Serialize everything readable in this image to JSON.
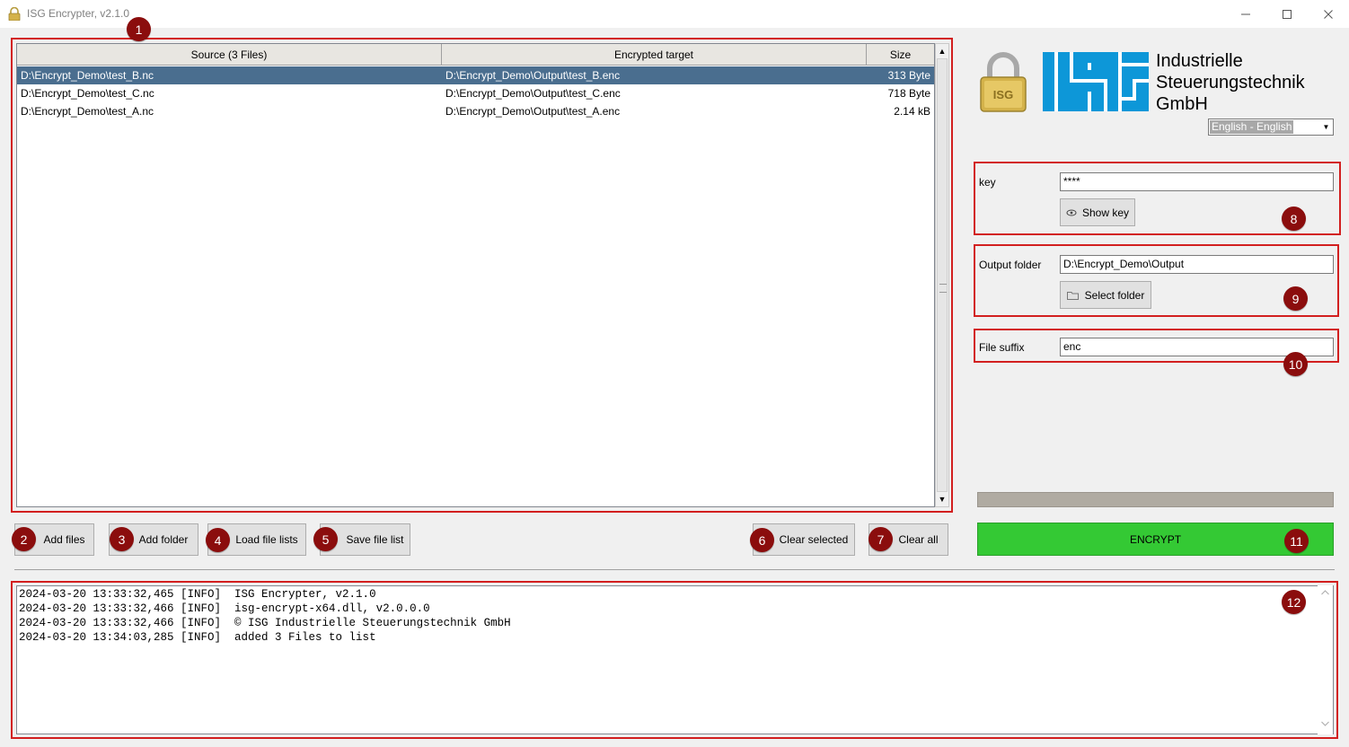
{
  "window": {
    "title": "ISG Encrypter, v2.1.0",
    "minimize_icon": "minimize-icon",
    "maximize_icon": "maximize-icon",
    "close_icon": "close-icon"
  },
  "file_table": {
    "columns": [
      "Source (3 Files)",
      "Encrypted target",
      "Size"
    ],
    "rows": [
      {
        "source": "D:\\Encrypt_Demo\\test_B.nc",
        "target": "D:\\Encrypt_Demo\\Output\\test_B.enc",
        "size": "313 Byte",
        "selected": true
      },
      {
        "source": "D:\\Encrypt_Demo\\test_C.nc",
        "target": "D:\\Encrypt_Demo\\Output\\test_C.enc",
        "size": "718 Byte",
        "selected": false
      },
      {
        "source": "D:\\Encrypt_Demo\\test_A.nc",
        "target": "D:\\Encrypt_Demo\\Output\\test_A.enc",
        "size": "2.14 kB",
        "selected": false
      }
    ]
  },
  "toolbar": {
    "add_files": "Add files",
    "add_folder": "Add folder",
    "load_file_lists": "Load file lists",
    "save_file_list": "Save file list",
    "clear_selected": "Clear selected",
    "clear_all": "Clear all"
  },
  "brand": {
    "logo_text": "ISG",
    "company_line1": "Industrielle",
    "company_line2": "Steuerungstechnik",
    "company_line3": "GmbH",
    "logo_color": "#0d97d8",
    "padlock_color": "#d4b24a"
  },
  "language": {
    "selected": "English - English"
  },
  "key_section": {
    "label": "key",
    "value": "****",
    "show_key": "Show key"
  },
  "output_section": {
    "label": "Output folder",
    "value": "D:\\Encrypt_Demo\\Output",
    "select_folder": "Select folder"
  },
  "suffix_section": {
    "label": "File suffix",
    "value": "enc"
  },
  "progress": {
    "value": 0
  },
  "encrypt": {
    "label": "ENCRYPT",
    "color": "#34c934"
  },
  "log": {
    "lines": [
      "2024-03-20 13:33:32,465 [INFO]  ISG Encrypter, v2.1.0",
      "2024-03-20 13:33:32,466 [INFO]  isg-encrypt-x64.dll, v2.0.0.0",
      "2024-03-20 13:33:32,466 [INFO]  © ISG Industrielle Steuerungstechnik GmbH",
      "2024-03-20 13:34:03,285 [INFO]  added 3 Files to list"
    ]
  },
  "annotations": {
    "badges": [
      "1",
      "2",
      "3",
      "4",
      "5",
      "6",
      "7",
      "8",
      "9",
      "10",
      "11",
      "12"
    ],
    "highlight_color": "#d21f1f",
    "badge_color": "#8b0d0d"
  }
}
